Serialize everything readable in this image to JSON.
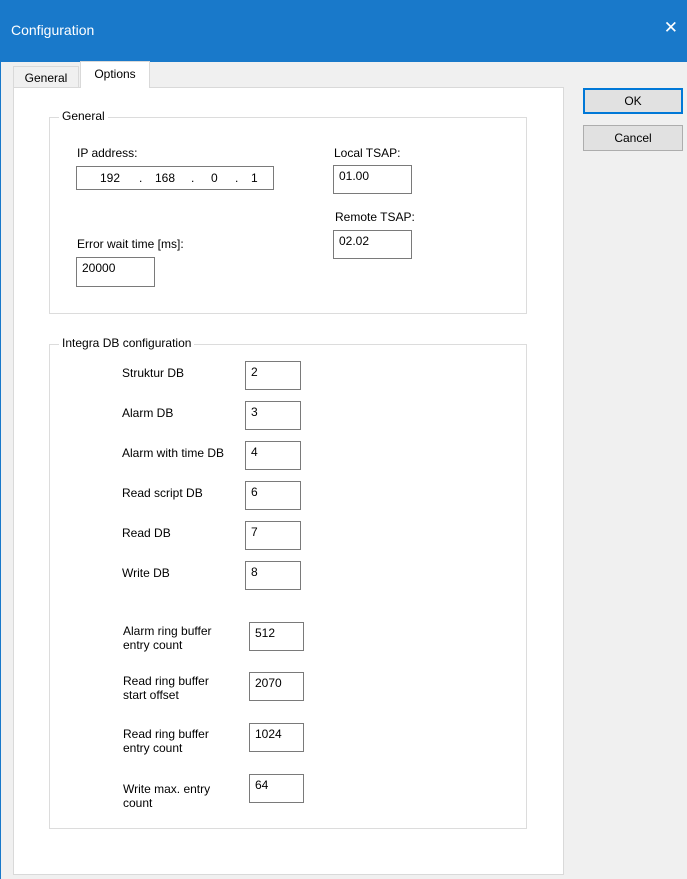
{
  "window": {
    "title": "Configuration",
    "close_glyph": "✕"
  },
  "tabs": [
    {
      "label": "General",
      "selected": false
    },
    {
      "label": "Options",
      "selected": true
    }
  ],
  "general_group": {
    "legend": "General",
    "ip_label": "IP address:",
    "ip_octets": [
      "192",
      "168",
      "0",
      "1"
    ],
    "ip_dot": ".",
    "local_tsap_label": "Local TSAP:",
    "local_tsap_value": "01.00",
    "remote_tsap_label": "Remote TSAP:",
    "remote_tsap_value": "02.02",
    "error_wait_label": "Error wait time [ms]:",
    "error_wait_value": "20000"
  },
  "db_group": {
    "legend": "Integra DB configuration",
    "rows": [
      {
        "label": "Struktur DB",
        "value": "2"
      },
      {
        "label": "Alarm DB",
        "value": "3"
      },
      {
        "label": "Alarm with time DB",
        "value": "4"
      },
      {
        "label": "Read script DB",
        "value": "6"
      },
      {
        "label": "Read DB",
        "value": "7"
      },
      {
        "label": "Write DB",
        "value": "8"
      }
    ],
    "buffers": [
      {
        "label_line1": "Alarm ring buffer",
        "label_line2": "entry count",
        "value": "512"
      },
      {
        "label_line1": "Read ring buffer",
        "label_line2": "start offset",
        "value": "2070"
      },
      {
        "label_line1": "Read ring buffer",
        "label_line2": "entry count",
        "value": "1024"
      },
      {
        "label_line1": "Write max. entry",
        "label_line2": "count",
        "value": "64"
      }
    ]
  },
  "buttons": {
    "ok": "OK",
    "cancel": "Cancel"
  },
  "colors": {
    "titlebar": "#1979ca",
    "window_bg": "#f0f0f0",
    "panel_bg": "#ffffff",
    "default_button_border": "#0078d7"
  }
}
